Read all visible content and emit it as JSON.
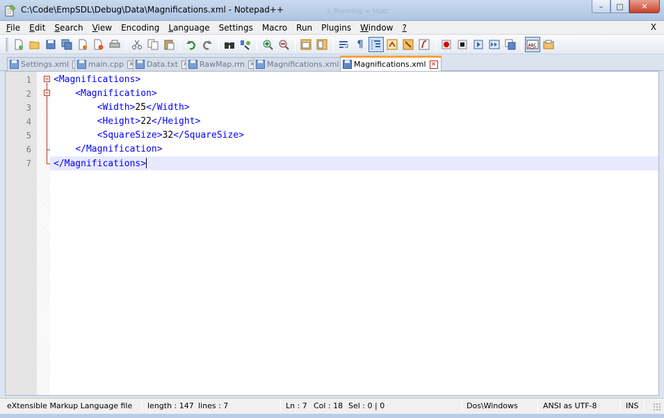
{
  "window": {
    "title": "C:\\Code\\EmpSDL\\Debug\\Data\\Magnifications.xml - Notepad++",
    "background_text": "s_Running = true;",
    "minimize": "–",
    "maximize": "□",
    "close": "✕"
  },
  "menu": {
    "items": [
      {
        "key": "F",
        "rest": "ile"
      },
      {
        "key": "E",
        "rest": "dit"
      },
      {
        "key": "S",
        "rest": "earch"
      },
      {
        "key": "V",
        "rest": "iew"
      },
      {
        "key": "",
        "rest": "Encoding"
      },
      {
        "key": "L",
        "rest": "anguage"
      },
      {
        "key": "",
        "rest": "Settings"
      },
      {
        "key": "",
        "rest": "Macro"
      },
      {
        "key": "",
        "rest": "Run"
      },
      {
        "key": "",
        "rest": "Plugins"
      },
      {
        "key": "W",
        "rest": "indow"
      },
      {
        "key": "?",
        "rest": ""
      }
    ],
    "close": "X"
  },
  "toolbar": {
    "icons": [
      "new-file-icon",
      "open-file-icon",
      "save-icon",
      "save-all-icon",
      "close-icon",
      "close-all-icon",
      "print-icon",
      "cut-icon",
      "copy-icon",
      "paste-icon",
      "undo-icon",
      "redo-icon",
      "find-icon",
      "replace-icon",
      "zoom-in-icon",
      "zoom-out-icon",
      "sync-vertical-icon",
      "sync-horizontal-icon",
      "word-wrap-icon",
      "show-all-chars-icon",
      "indent-guide-icon",
      "user-language-icon",
      "document-map-icon",
      "function-list-icon",
      "record-macro-icon",
      "stop-record-icon",
      "play-macro-icon",
      "run-macro-multiple-icon",
      "save-macro-icon",
      "spell-check-icon",
      "document-switcher-icon"
    ]
  },
  "tabs": [
    {
      "label": "Settings.xml",
      "active": false
    },
    {
      "label": "main.cpp",
      "active": false
    },
    {
      "label": "Data.txt",
      "active": false
    },
    {
      "label": "RawMap.rm",
      "active": false
    },
    {
      "label": "Magnifications.xml",
      "active": false
    },
    {
      "label": "Magnifications.xml",
      "active": true
    }
  ],
  "editor": {
    "lines": [
      {
        "num": "1",
        "indent": "",
        "open": "<Magnifications>",
        "text": "",
        "close": ""
      },
      {
        "num": "2",
        "indent": "    ",
        "open": "<Magnification>",
        "text": "",
        "close": ""
      },
      {
        "num": "3",
        "indent": "        ",
        "open": "<Width>",
        "text": "25",
        "close": "</Width>"
      },
      {
        "num": "4",
        "indent": "        ",
        "open": "<Height>",
        "text": "22",
        "close": "</Height>"
      },
      {
        "num": "5",
        "indent": "        ",
        "open": "<SquareSize>",
        "text": "32",
        "close": "</SquareSize>"
      },
      {
        "num": "6",
        "indent": "    ",
        "open": "</Magnification>",
        "text": "",
        "close": ""
      },
      {
        "num": "7",
        "indent": "",
        "open": "</Magnifications>",
        "text": "",
        "close": ""
      }
    ],
    "current_line": 7
  },
  "status": {
    "file_type": "eXtensible Markup Language file",
    "length": "length : 147",
    "lines": "lines : 7",
    "ln": "Ln : 7",
    "col": "Col : 18",
    "sel": "Sel : 0 | 0",
    "eol": "Dos\\Windows",
    "encoding": "ANSI as UTF-8",
    "mode": "INS"
  },
  "colors": {
    "tag": "#0000ff",
    "fold": "#c0392b",
    "current_line": "#e8e8ff",
    "active_tab_accent": "#f8a23a"
  }
}
